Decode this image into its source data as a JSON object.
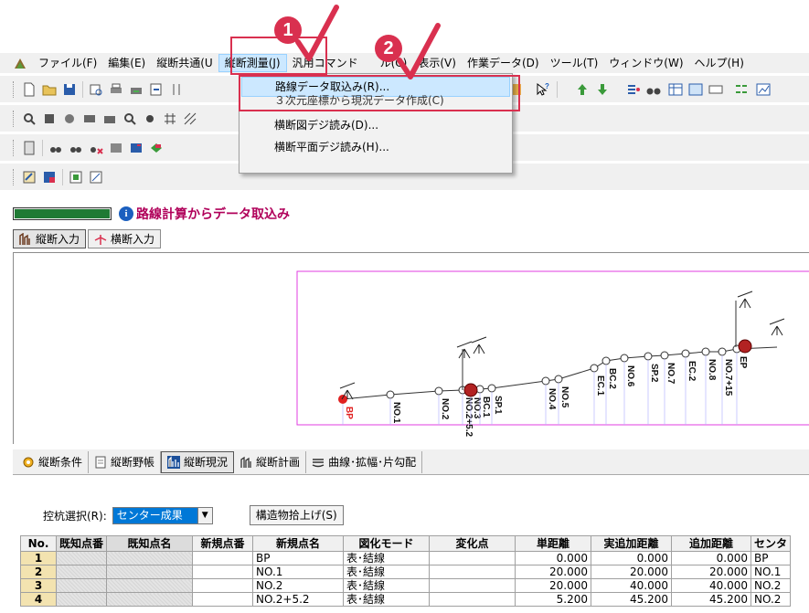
{
  "menubar": {
    "items": [
      "ファイル(F)",
      "編集(E)",
      "縦断共通(U)",
      "縦断測量(J)",
      "汎用コマンド(C)",
      "表示(V)",
      "作業データ(D)",
      "ツール(T)",
      "ウィンドウ(W)",
      "ヘルプ(H)"
    ],
    "item_0": "ファイル(F)",
    "item_1": "編集(E)",
    "item_2": "縦断共通(U",
    "item_3": "縦断測量(J)",
    "item_4": "汎用コマンド",
    "item_5": "ル(C)",
    "item_6": "表示(V)",
    "item_7": "作業データ(D)",
    "item_8": "ツール(T)",
    "item_9": "ウィンドウ(W)",
    "item_10": "ヘルプ(H)"
  },
  "dropdown": {
    "item_import": "路線データ取込み(R)...",
    "item_partial": "３次元座標から現況データ作成(C)",
    "item_cross_digi": "横断図デジ読み(D)...",
    "item_plan_digi": "横断平面デジ読み(H)..."
  },
  "annotations": {
    "badge_1": "1",
    "badge_2": "2",
    "accent": "#d9304f"
  },
  "status": {
    "progress_percent": 100,
    "text": "路線計算からデータ取込み"
  },
  "input_tabs": {
    "profile": "縦断入力",
    "cross": "横断入力"
  },
  "profile_labels": [
    "BP",
    "NO.1",
    "NO.2",
    "NO.2+5.2",
    "NO.3",
    "BC.1",
    "SP.1",
    "NO.4",
    "NO.5",
    "EC.1",
    "BC.2",
    "NO.6",
    "SP.2",
    "NO.7",
    "EC.2",
    "NO.8",
    "NO.7+15",
    "EP"
  ],
  "bottom_tabs": {
    "t1": "縦断条件",
    "t2": "縦断野帳",
    "t3": "縦断現況",
    "t4": "縦断計画",
    "t5": "曲線･拡幅･片勾配"
  },
  "stake": {
    "label": "控杭選択(R):",
    "value": "センター成果",
    "struct_button": "構造物拾上げ(S)"
  },
  "table": {
    "headers": {
      "no": "No.",
      "known_no": "既知点番",
      "known_name": "既知点名",
      "new_no": "新規点番",
      "new_name": "新規点名",
      "mode": "図化モード",
      "change": "変化点",
      "dist": "単距離",
      "real_cum": "実追加距離",
      "cum": "追加距離",
      "center": "センタ"
    },
    "rows": [
      {
        "no": "1",
        "new_name": "BP",
        "mode": "表･結線",
        "dist": "0.000",
        "real_cum": "0.000",
        "cum": "0.000",
        "center": "BP"
      },
      {
        "no": "2",
        "new_name": "NO.1",
        "mode": "表･結線",
        "dist": "20.000",
        "real_cum": "20.000",
        "cum": "20.000",
        "center": "NO.1"
      },
      {
        "no": "3",
        "new_name": "NO.2",
        "mode": "表･結線",
        "dist": "20.000",
        "real_cum": "40.000",
        "cum": "40.000",
        "center": "NO.2"
      },
      {
        "no": "4",
        "new_name": "NO.2+5.2",
        "mode": "表･結線",
        "dist": "5.200",
        "real_cum": "45.200",
        "cum": "45.200",
        "center": "NO.2"
      }
    ]
  }
}
